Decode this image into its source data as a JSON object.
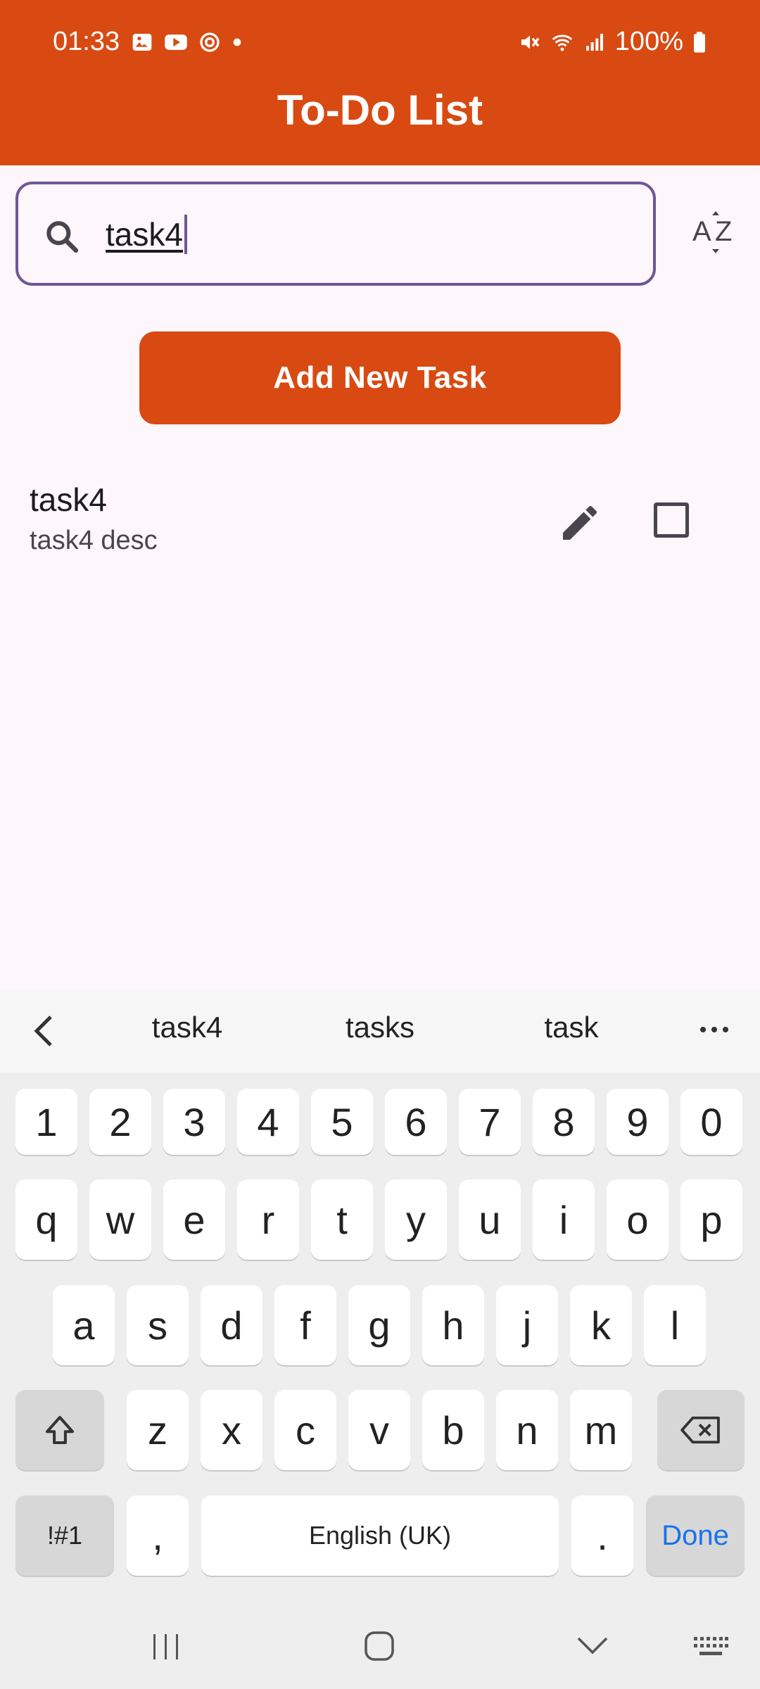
{
  "status_bar": {
    "time": "01:33",
    "battery": "100%",
    "left_icons": [
      "gallery-icon",
      "youtube-icon",
      "sync-icon",
      "dot-icon"
    ],
    "right_icons": [
      "mute-icon",
      "wifi-icon",
      "signal-icon",
      "battery-icon"
    ]
  },
  "app": {
    "title": "To-Do List",
    "accent_color": "#d84a12",
    "focus_color": "#6e5797"
  },
  "search": {
    "value": "task4",
    "icon": "search-icon"
  },
  "sort": {
    "icon": "sort-az-icon"
  },
  "add_button": {
    "label": "Add New Task"
  },
  "tasks": [
    {
      "title": "task4",
      "description": "task4 desc",
      "completed": false
    }
  ],
  "keyboard": {
    "suggestions": [
      "task4",
      "tasks",
      "task"
    ],
    "row_numbers": [
      "1",
      "2",
      "3",
      "4",
      "5",
      "6",
      "7",
      "8",
      "9",
      "0"
    ],
    "row_q": [
      "q",
      "w",
      "e",
      "r",
      "t",
      "y",
      "u",
      "i",
      "o",
      "p"
    ],
    "row_a": [
      "a",
      "s",
      "d",
      "f",
      "g",
      "h",
      "j",
      "k",
      "l"
    ],
    "row_z": [
      "z",
      "x",
      "c",
      "v",
      "b",
      "n",
      "m"
    ],
    "symbols_label": "!#1",
    "comma_label": ",",
    "space_label": "English (UK)",
    "period_label": ".",
    "done_label": "Done"
  }
}
